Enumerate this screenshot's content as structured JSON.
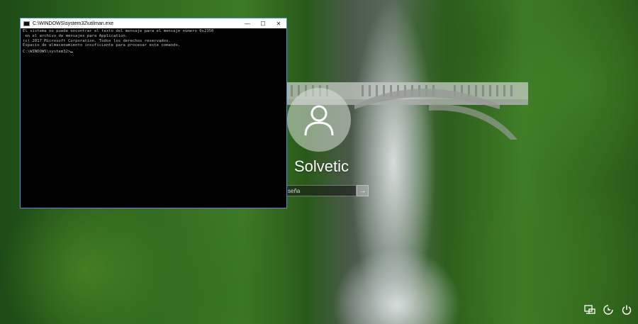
{
  "cmd": {
    "title": "C:\\WINDOWS\\system32\\utilman.exe",
    "line1": "El sistema no puede encontrar el texto del mensaje para el mensaje número 0x2350",
    "line2": " en el archivo de mensajes para Application.",
    "line3": "",
    "line4": "(c) 2017 Microsoft Corporation. Todos los derechos reservados.",
    "line5": "Espacio de almacenamiento insuficiente para procesar este comando.",
    "line6": "",
    "prompt": "C:\\WINDOWS\\system32>",
    "minimize": "—",
    "maximize": "☐",
    "close": "✕"
  },
  "login": {
    "username": "Solvetic",
    "password_placeholder": "seña",
    "submit_glyph": "→"
  },
  "icons": {
    "network": "network-icon",
    "ease_of_access": "ease-of-access-icon",
    "power": "power-icon"
  }
}
